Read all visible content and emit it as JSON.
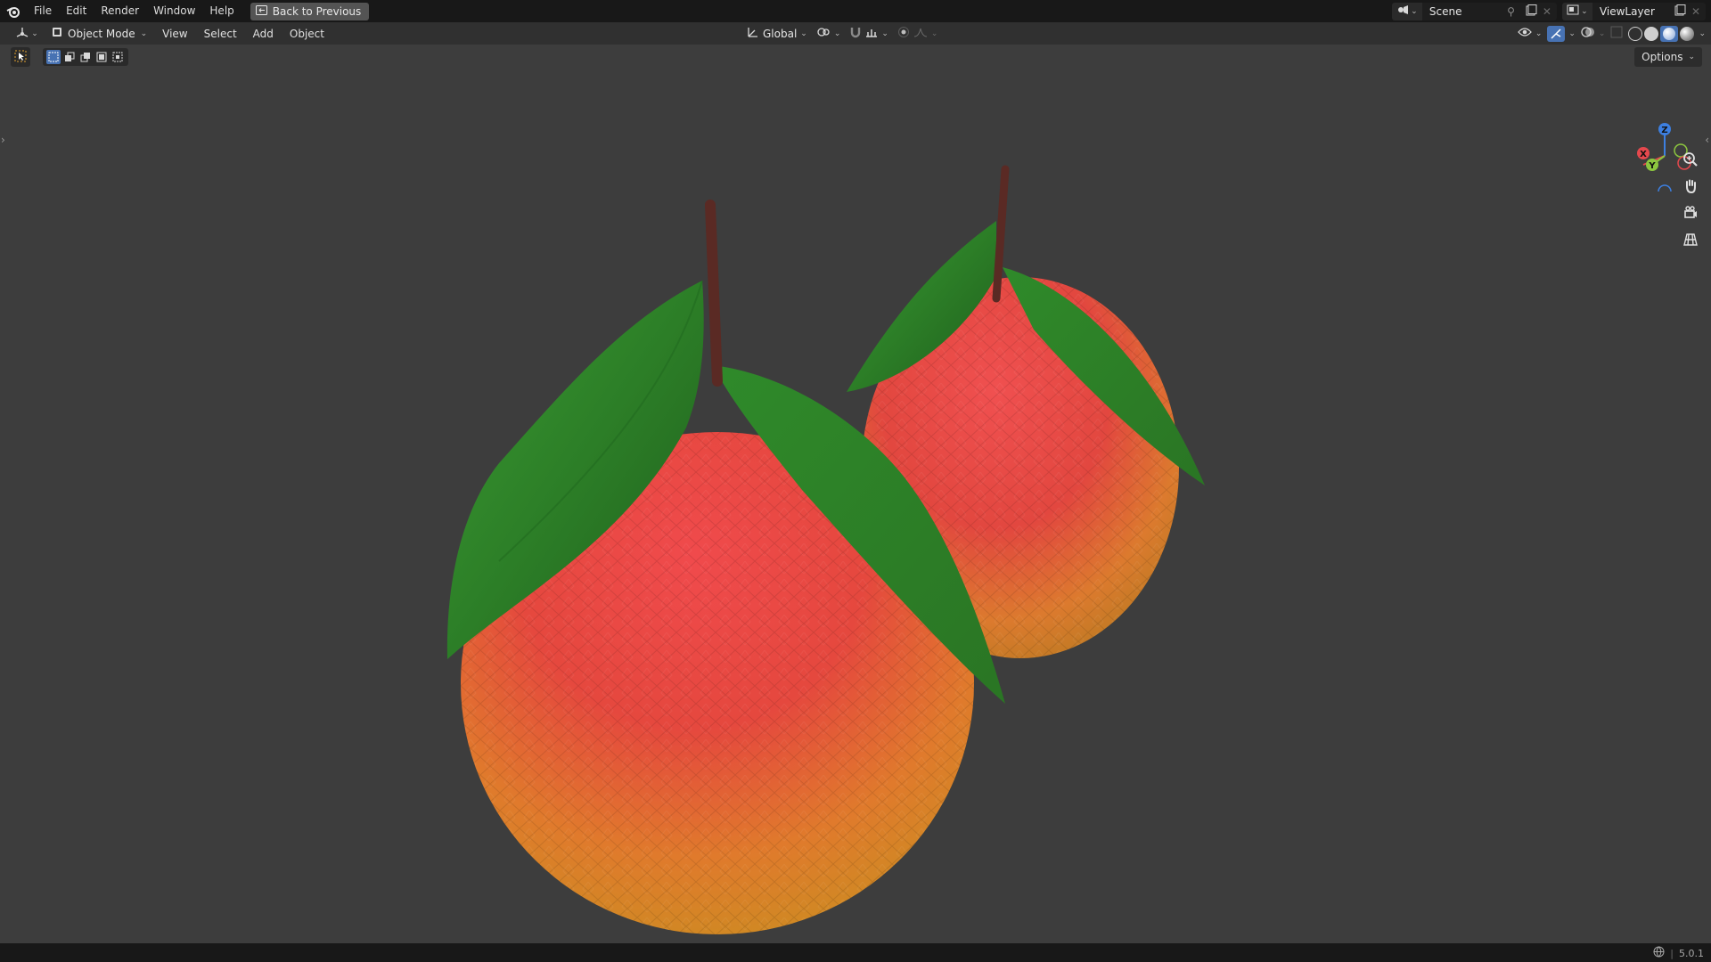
{
  "menubar": {
    "items": [
      {
        "label": "File"
      },
      {
        "label": "Edit"
      },
      {
        "label": "Render"
      },
      {
        "label": "Window"
      },
      {
        "label": "Help"
      }
    ],
    "back_label": "Back to Previous",
    "scene_name": "Scene",
    "view_layer_name": "ViewLayer"
  },
  "viewport_header": {
    "mode": "Object Mode",
    "menus": [
      {
        "label": "View"
      },
      {
        "label": "Select"
      },
      {
        "label": "Add"
      },
      {
        "label": "Object"
      }
    ],
    "orientation": "Global"
  },
  "tool_settings": {
    "options_label": "Options"
  },
  "gizmo": {
    "x_label": "X",
    "y_label": "Y",
    "z_label": "Z",
    "x_color": "#e5484d",
    "y_color": "#8cc63f",
    "z_color": "#3d7fe0"
  },
  "scene": {
    "objects": [
      "orange-front",
      "orange-back"
    ],
    "background": "#3d3d3d",
    "fruit_top_color": "#e0383f",
    "fruit_bottom_color": "#e0a02a",
    "leaf_color": "#2e8a2a",
    "stem_color": "#5a2a24"
  },
  "statusbar": {
    "version": "5.0.1"
  },
  "icons": {
    "logo": "blender-logo-icon",
    "zoom": "zoom-icon",
    "pan": "hand-icon",
    "camera": "camera-icon",
    "grid": "grid-icon"
  }
}
